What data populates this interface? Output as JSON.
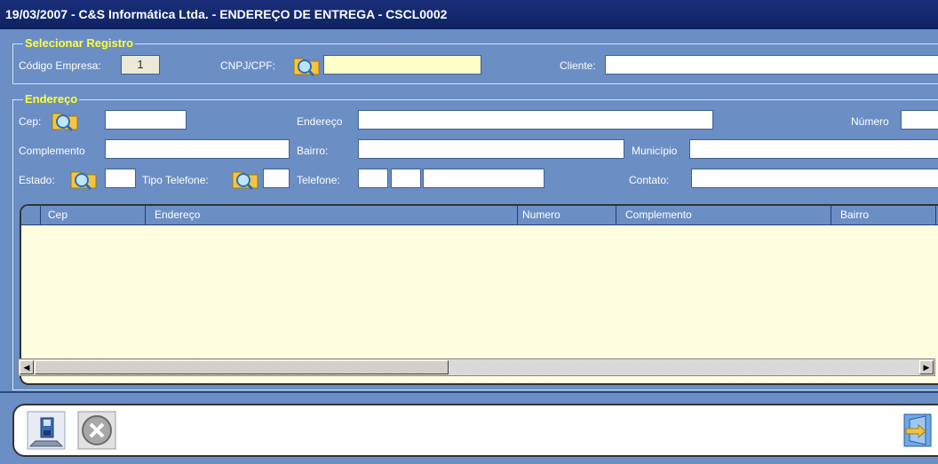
{
  "title": "19/03/2007  -  C&S Informática Ltda.  -  ENDEREÇO DE ENTREGA  -  CSCL0002",
  "selecionar": {
    "legend": "Selecionar Registro",
    "codigo_empresa_label": "Código Empresa:",
    "codigo_empresa_value": "1",
    "cnpj_label": "CNPJ/CPF:",
    "cnpj_value": "",
    "cliente_label": "Cliente:",
    "cliente_value": ""
  },
  "endereco": {
    "legend": "Endereço",
    "cep_label": "Cep:",
    "endereco_label": "Endereço",
    "numero_label": "Número",
    "complemento_label": "Complemento",
    "bairro_label": "Bairro:",
    "municipio_label": "Município",
    "estado_label": "Estado:",
    "tipo_telefone_label": "Tipo Telefone:",
    "telefone_label": "Telefone:",
    "contato_label": "Contato:"
  },
  "grid": {
    "columns": [
      "Cep",
      "Endereço",
      "Numero",
      "Complemento",
      "Bairro"
    ],
    "rows": []
  },
  "icons": {
    "lookup": "magnifier-folder-icon",
    "save": "save-disk-icon",
    "cancel": "cancel-x-icon",
    "exit": "exit-door-icon"
  },
  "colors": {
    "titlebar": "#0e2262",
    "panel": "#6b8ec5",
    "legend": "#ffff33",
    "grid_bg": "#fefde0"
  }
}
